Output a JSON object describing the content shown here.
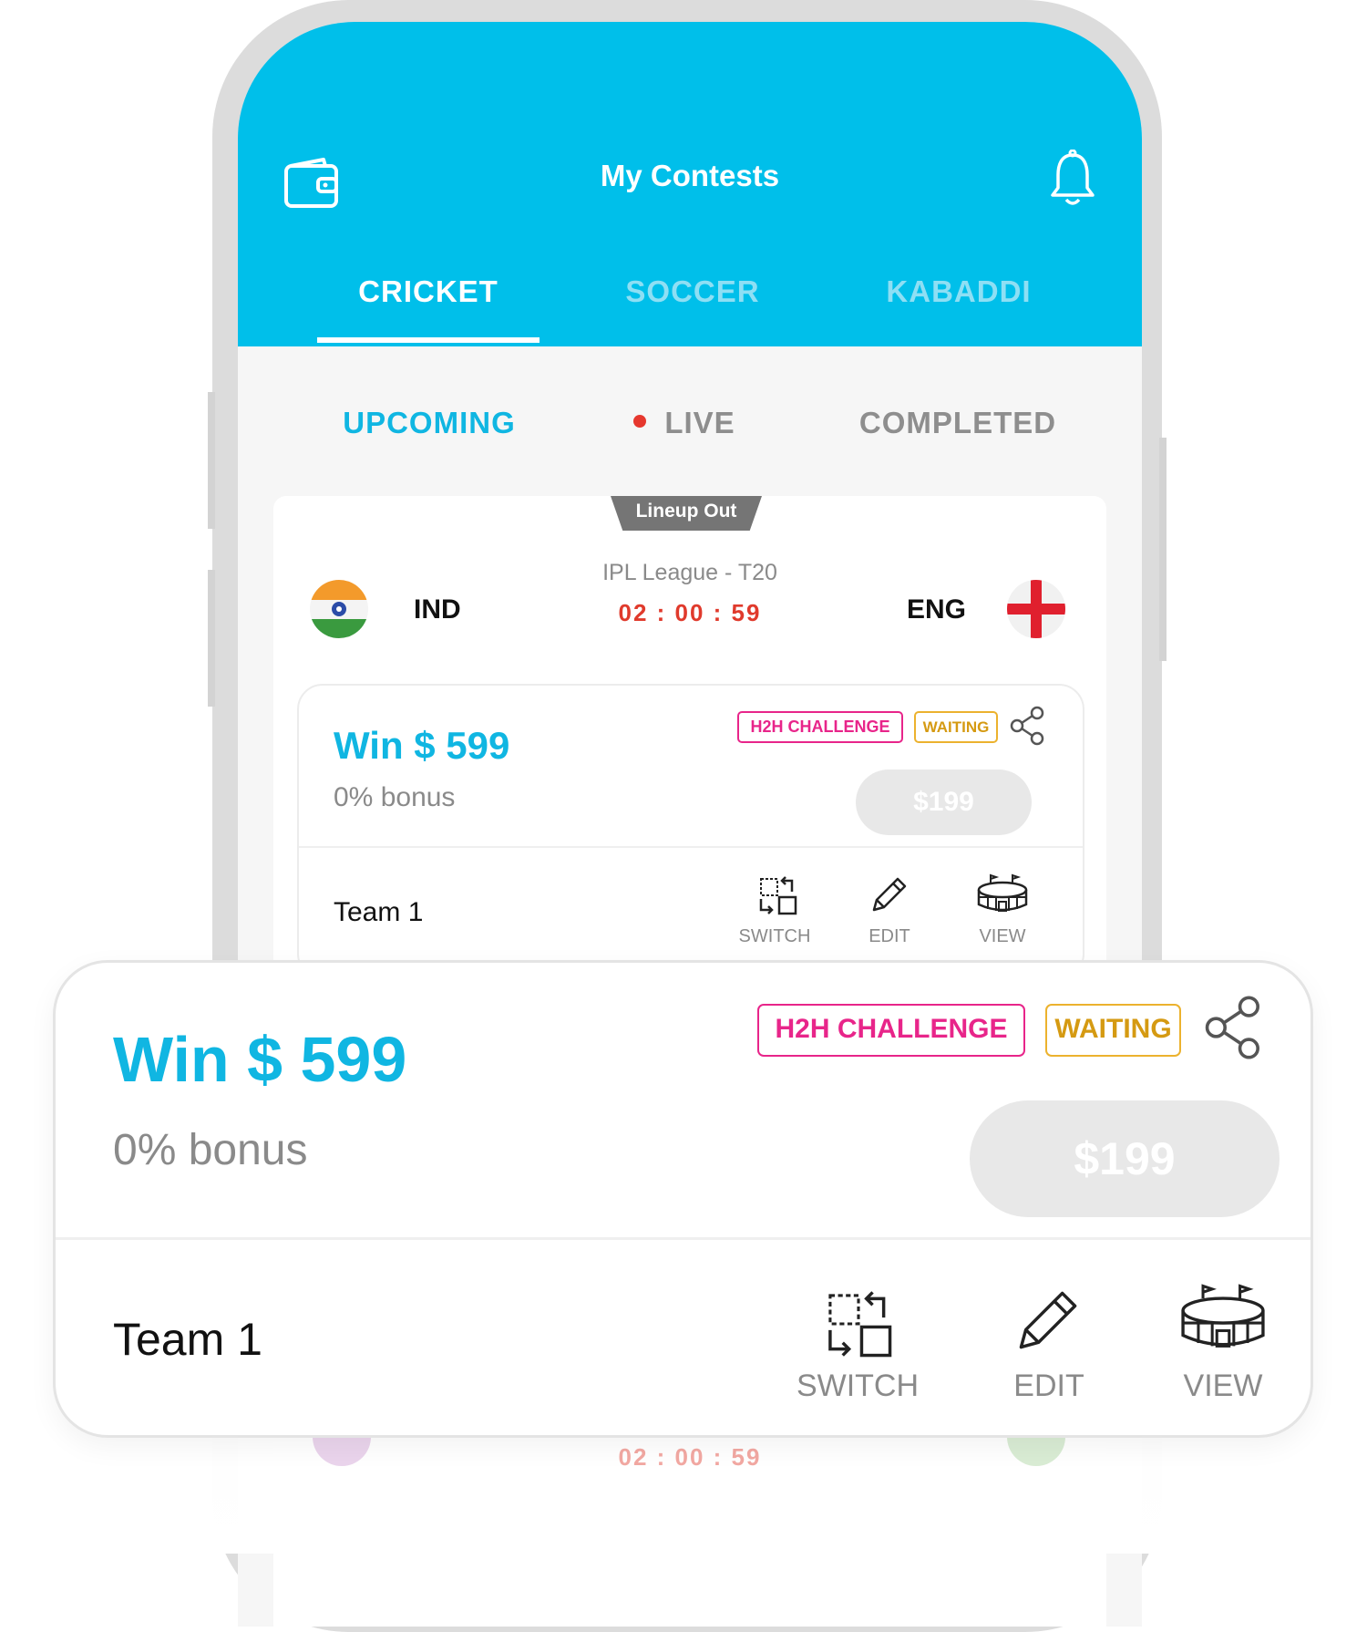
{
  "header": {
    "title": "My Contests",
    "wallet_icon": "wallet-icon",
    "bell_icon": "bell-icon"
  },
  "sport_tabs": [
    {
      "label": "CRICKET",
      "active": true
    },
    {
      "label": "SOCCER",
      "active": false
    },
    {
      "label": "KABADDI",
      "active": false
    }
  ],
  "status_tabs": [
    {
      "label": "UPCOMING",
      "active": true
    },
    {
      "label": "LIVE",
      "active": false
    },
    {
      "label": "COMPLETED",
      "active": false
    }
  ],
  "match": {
    "tag": "Lineup Out",
    "team_left": "IND",
    "team_right": "ENG",
    "league": "IPL League - T20",
    "timer": "02 : 00 : 59"
  },
  "contest": {
    "win": "Win $ 599",
    "bonus": "0% bonus",
    "badge_h2h": "H2H CHALLENGE",
    "badge_waiting": "WAITING",
    "entry_fee": "$199",
    "team": "Team 1",
    "actions": {
      "switch": "SWITCH",
      "edit": "EDIT",
      "view": "VIEW"
    }
  },
  "colors": {
    "header_bg": "#00bfea",
    "accent": "#10b6e2",
    "live_dot": "#e6382e",
    "timer": "#e03a2c",
    "h2h": "#e8258a",
    "waiting": "#ecb22e"
  }
}
